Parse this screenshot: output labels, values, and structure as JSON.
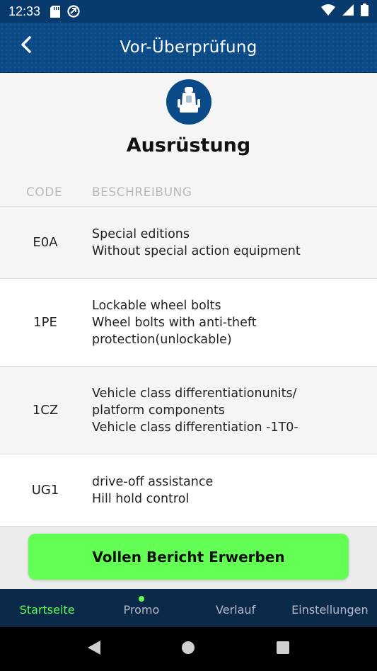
{
  "status_bar": {
    "time": "12:33",
    "icons_left": [
      "sd-card-icon",
      "vpn-icon"
    ],
    "icons_right": [
      "wifi-icon",
      "signal-icon",
      "battery-icon"
    ]
  },
  "app_bar": {
    "title": "Vor-Überprüfung",
    "back_icon": "chevron-left-icon"
  },
  "section": {
    "icon": "car-seat-icon",
    "heading": "Ausrüstung"
  },
  "table": {
    "headers": {
      "code": "CODE",
      "description": "BESCHREIBUNG"
    },
    "rows": [
      {
        "code": "E0A",
        "lines": [
          "Special editions",
          "Without special action equipment"
        ]
      },
      {
        "code": "1PE",
        "lines": [
          "Lockable wheel bolts",
          "Wheel bolts with anti-theft",
          "protection(unlockable)"
        ]
      },
      {
        "code": "1CZ",
        "lines": [
          "Vehicle class differentiationunits/",
          "platform components",
          "Vehicle class differentiation -1T0-"
        ]
      },
      {
        "code": "UG1",
        "lines": [
          "drive-off assistance",
          "Hill hold control"
        ]
      }
    ]
  },
  "buy_button": {
    "label": "Vollen Bericht Erwerben"
  },
  "bottom_nav": {
    "items": [
      {
        "label": "Startseite",
        "active": true
      },
      {
        "label": "Promo",
        "badge": true
      },
      {
        "label": "Verlauf"
      },
      {
        "label": "Einstellungen"
      }
    ]
  },
  "colors": {
    "primary": "#0a4a86",
    "accent": "#63ff55",
    "nav_bg": "#0b2a4a"
  }
}
